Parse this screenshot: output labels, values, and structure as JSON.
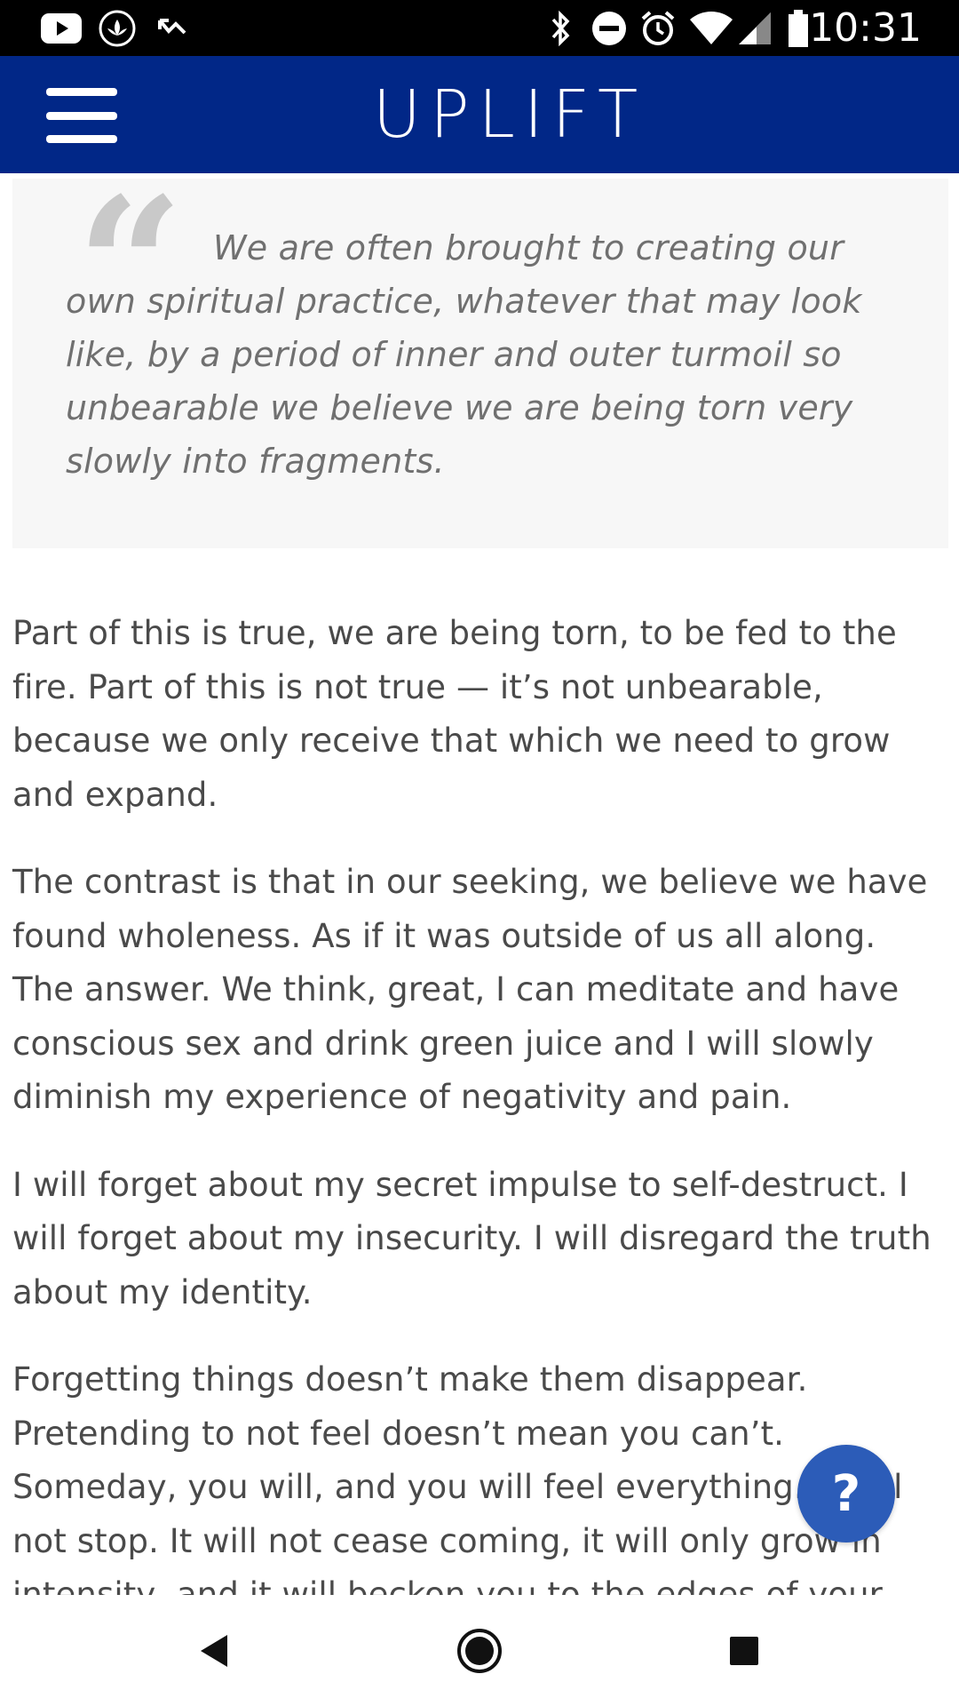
{
  "status_bar": {
    "time": "10:31",
    "left_icons": [
      "youtube-icon",
      "lotus-icon",
      "missed-call-icon"
    ],
    "right_icons": [
      "bluetooth-icon",
      "do-not-disturb-icon",
      "alarm-icon",
      "wifi-icon",
      "cell-signal-icon",
      "battery-icon"
    ]
  },
  "header": {
    "title": "UPLIFT",
    "background": "#012787"
  },
  "article": {
    "quote": "We are often brought to creating our own spiritual practice, whatever that may look like, by a period of inner and outer turmoil so unbearable we believe we are being torn very slowly into fragments.",
    "paragraphs": [
      "Part of this is true, we are being torn, to be fed to the fire. Part of this is not true — it’s not unbearable, because we only receive that which we need to grow and expand.",
      "The contrast is that in our seeking, we believe we have found wholeness. As if it was outside of us all along. The answer. We think, great, I can meditate and have conscious sex and drink green juice and I will slowly diminish my experience of negativity and pain.",
      "I will forget about my secret impulse to self-destruct. I will forget about my insecurity. I will disregard the truth about my identity.",
      "Forgetting things doesn’t make them disappear. Pretending to not feel doesn’t mean you can’t. Someday, you will, and you will feel everything. It will not stop. It will not cease coming, it will only grow in intensity, and it will beckon you to the edges of your"
    ]
  },
  "help_button": {
    "label": "?",
    "color": "#2c5cb8"
  },
  "nav_bar": {
    "buttons": [
      "back-icon",
      "home-icon",
      "recents-icon"
    ]
  }
}
